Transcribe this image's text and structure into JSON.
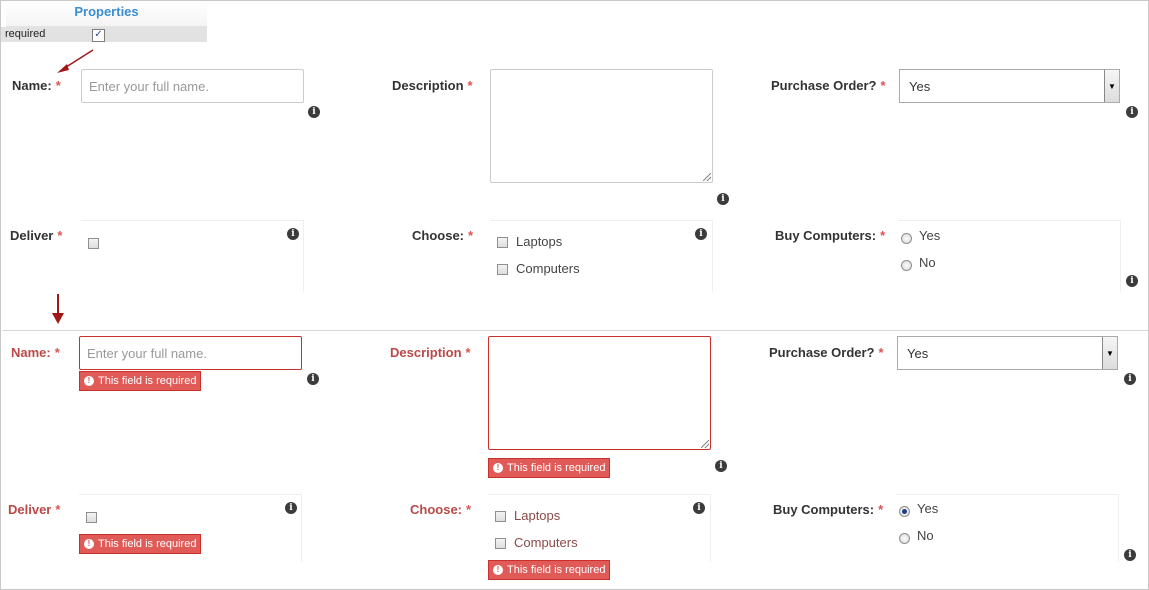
{
  "properties": {
    "title": "Properties",
    "required_label": "required",
    "required_checked": true
  },
  "form_before": {
    "name": {
      "label": "Name:",
      "asterisk": "*",
      "placeholder": "Enter your full name."
    },
    "description": {
      "label": "Description",
      "asterisk": "*"
    },
    "purchase_order": {
      "label": "Purchase Order?",
      "asterisk": "*",
      "value": "Yes"
    },
    "deliver": {
      "label": "Deliver",
      "asterisk": "*"
    },
    "choose": {
      "label": "Choose:",
      "asterisk": "*",
      "options": [
        "Laptops",
        "Computers"
      ]
    },
    "buy_computers": {
      "label": "Buy Computers:",
      "asterisk": "*",
      "options": [
        "Yes",
        "No"
      ],
      "selected": null
    }
  },
  "form_after": {
    "name": {
      "label": "Name:",
      "asterisk": "*",
      "placeholder": "Enter your full name.",
      "error": "This field is required"
    },
    "description": {
      "label": "Description",
      "asterisk": "*",
      "error": "This field is required"
    },
    "purchase_order": {
      "label": "Purchase Order?",
      "asterisk": "*",
      "value": "Yes"
    },
    "deliver": {
      "label": "Deliver",
      "asterisk": "*",
      "error": "This field is required"
    },
    "choose": {
      "label": "Choose:",
      "asterisk": "*",
      "options": [
        "Laptops",
        "Computers"
      ],
      "error": "This field is required"
    },
    "buy_computers": {
      "label": "Buy Computers:",
      "asterisk": "*",
      "options": [
        "Yes",
        "No"
      ],
      "selected": "Yes"
    }
  },
  "icons": {
    "info": "info-icon",
    "error": "exclamation-circle-icon",
    "arrow": "red-arrow-icon",
    "dropdown": "chevron-down-icon"
  },
  "colors": {
    "error_red": "#e05a57",
    "error_border": "#c9302c",
    "label_error": "#b94a48",
    "accent_blue": "#3a8ed2",
    "arrow_red": "#a01818"
  }
}
